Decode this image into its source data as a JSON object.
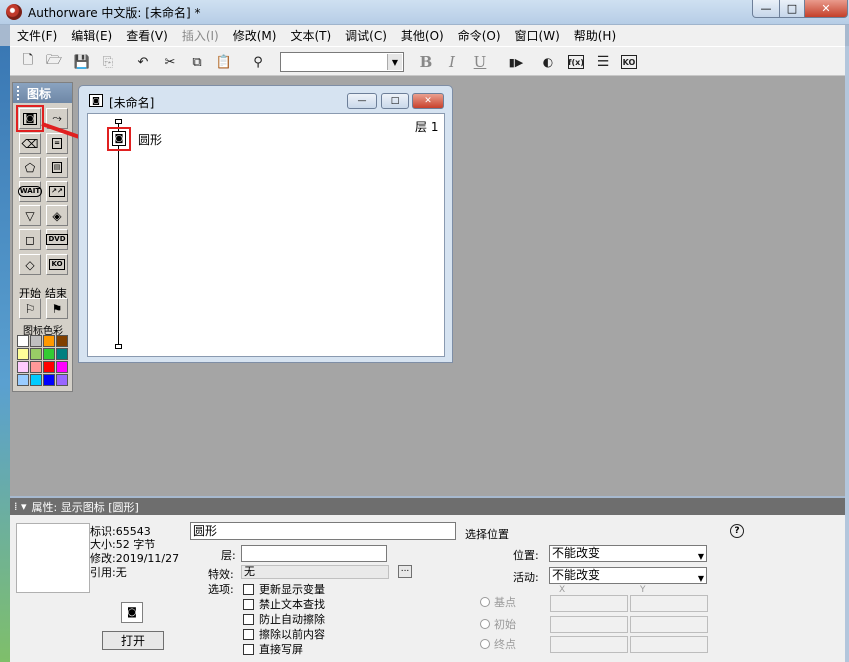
{
  "window": {
    "title": "Authorware 中文版: [未命名] *",
    "min_icon": "—",
    "max_icon": "□",
    "close_icon": "✕"
  },
  "menu": [
    "文件(F)",
    "编辑(E)",
    "查看(V)",
    "插入(I)",
    "修改(M)",
    "文本(T)",
    "调试(C)",
    "其他(O)",
    "命令(O)",
    "窗口(W)",
    "帮助(H)"
  ],
  "menu_disabled_index": 3,
  "toolbar": {
    "icons": [
      "new-file-icon",
      "open-folder-icon",
      "save-all-icon",
      "import-icon",
      "undo-icon",
      "cut-icon",
      "copy-icon",
      "paste-icon",
      "find-icon",
      "bold-icon",
      "italic-icon",
      "underline-icon",
      "run-icon",
      "control-panel-icon",
      "functions-icon",
      "variables-icon",
      "knowledge-objects-icon"
    ],
    "bold": "B",
    "italic": "I",
    "underline": "U",
    "fx": "f(x)",
    "ko": "KO",
    "font_value": ""
  },
  "palette": {
    "title": "图标",
    "start": "开始",
    "end": "结束",
    "color_label": "图标色彩",
    "wait": "WAIT",
    "dvd": "DVD",
    "ko": "KO",
    "swatches": [
      "#ffffff",
      "#c0c0c0",
      "#ff9900",
      "#804000",
      "#ffff99",
      "#99cc66",
      "#33cc33",
      "#008080",
      "#ffccff",
      "#ff9999",
      "#ff0000",
      "#ff00ff",
      "#99ccff",
      "#00ccff",
      "#0000ff",
      "#9966ff"
    ]
  },
  "flow_window": {
    "title": "[未命名]",
    "layer_label": "层 1",
    "icon_label": "圆形"
  },
  "properties": {
    "header": "属性: 显示图标 [圆形]",
    "id_label": "标识:65543",
    "size_label": "大小:52 字节",
    "modified_label": "修改:2019/11/27",
    "ref_label": "引用:无",
    "open_button": "打开",
    "name_value": "圆形",
    "layer_label": "层:",
    "effect_label": "特效:",
    "effect_value": "无",
    "effect_button": "...",
    "options_label": "选项:",
    "options": [
      "更新显示变量",
      "禁止文本查找",
      "防止自动擦除",
      "擦除以前内容",
      "直接写屏"
    ],
    "position_section": "选择位置",
    "position_label": "位置:",
    "position_value": "不能改变",
    "movable_label": "活动:",
    "movable_value": "不能改变",
    "base_label": "基点",
    "initial_label": "初始",
    "end_label": "终点",
    "axis_x": "X",
    "axis_y": "Y",
    "help": "?"
  }
}
